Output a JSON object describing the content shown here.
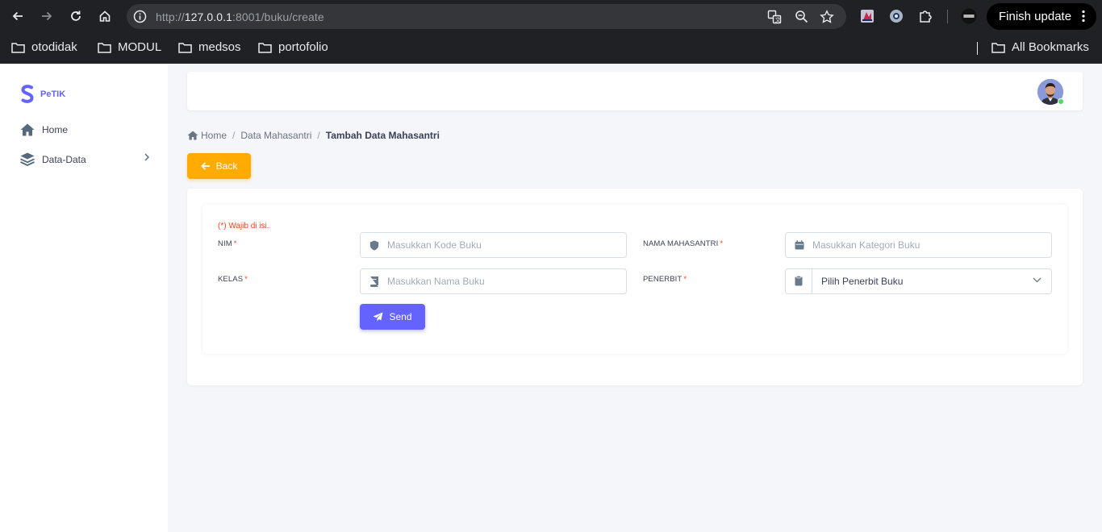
{
  "browser": {
    "url_prefix": "http://",
    "url_host": "127.0.0.1",
    "url_rest": ":8001/buku/create",
    "finish_update_label": "Finish update",
    "bookmarks": [
      "otodidak",
      "MODUL",
      "medsos",
      "portofolio"
    ],
    "all_bookmarks_label": "All Bookmarks"
  },
  "sidebar": {
    "logo_text": "PeTIK",
    "items": [
      {
        "label": "Home",
        "icon": "home-icon"
      },
      {
        "label": "Data-Data",
        "icon": "layers-icon"
      }
    ]
  },
  "breadcrumb": {
    "home": "Home",
    "parent": "Data Mahasantri",
    "current": "Tambah Data Mahasantri",
    "separator": "/"
  },
  "back_button": {
    "label": "Back"
  },
  "form": {
    "required_note": "(*) Wajib di isi.",
    "required_mark": "*",
    "nim": {
      "label": "NIM",
      "placeholder": "Masukkan Kode Buku"
    },
    "kelas": {
      "label": "KELAS",
      "placeholder": "Masukkan Nama Buku"
    },
    "nama": {
      "label": "NAMA MAHASANTRI",
      "placeholder": "Masukkan Kategori Buku"
    },
    "penerbit": {
      "label": "PENERBIT",
      "selected": "Pilih Penerbit Buku"
    },
    "send_label": "Send"
  },
  "colors": {
    "primary": "#6563ff",
    "warning": "#ffab00",
    "danger": "#ff3e1d",
    "online": "#4cd964"
  }
}
